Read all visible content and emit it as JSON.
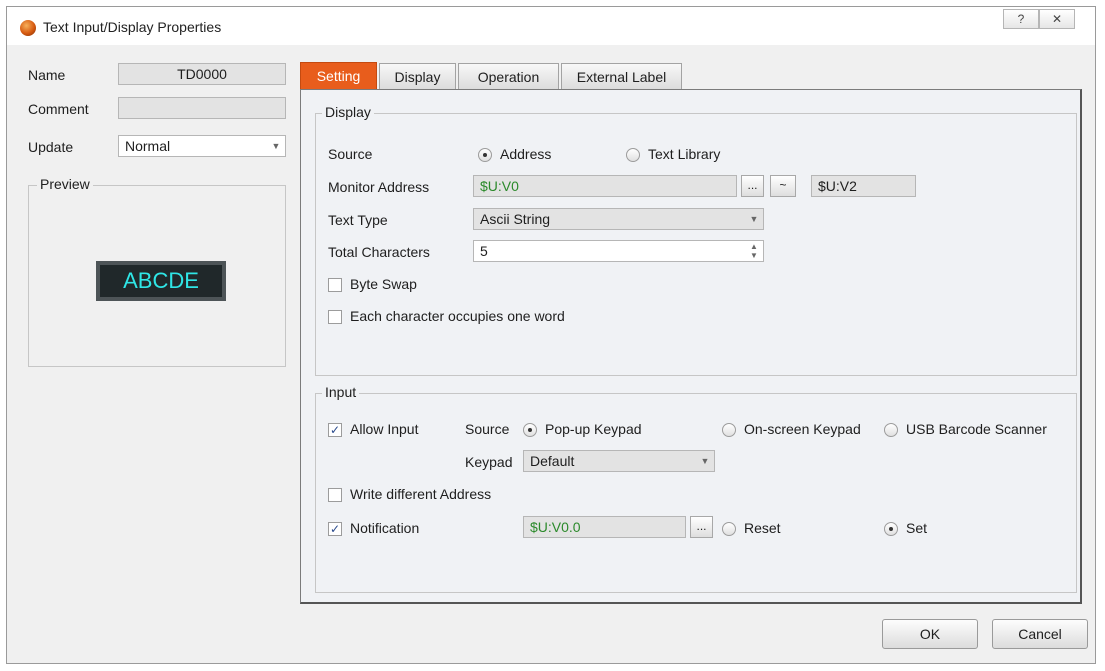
{
  "window": {
    "title": "Text Input/Display Properties",
    "help_label": "?",
    "close_label": "✕"
  },
  "left": {
    "name_label": "Name",
    "name_value": "TD0000",
    "comment_label": "Comment",
    "comment_value": "",
    "update_label": "Update",
    "update_value": "Normal",
    "preview_label": "Preview",
    "preview_text": "ABCDE"
  },
  "tabs": [
    {
      "label": "Setting",
      "active": true
    },
    {
      "label": "Display",
      "active": false
    },
    {
      "label": "Operation",
      "active": false
    },
    {
      "label": "External Label",
      "active": false
    }
  ],
  "display": {
    "group_label": "Display",
    "source_label": "Source",
    "source_address": "Address",
    "source_text_library": "Text Library",
    "monitor_address_label": "Monitor Address",
    "monitor_address_value": "$U:V0",
    "browse_label": "...",
    "range_label": "~",
    "monitor_address_end": "$U:V2",
    "text_type_label": "Text Type",
    "text_type_value": "Ascii String",
    "total_chars_label": "Total Characters",
    "total_chars_value": "5",
    "byte_swap_label": "Byte Swap",
    "each_char_label": "Each character occupies one word"
  },
  "input": {
    "group_label": "Input",
    "allow_input_label": "Allow Input",
    "allow_input_checked": true,
    "source_label": "Source",
    "popup_keypad": "Pop-up Keypad",
    "onscreen_keypad": "On-screen Keypad",
    "usb_barcode": "USB Barcode Scanner",
    "keypad_label": "Keypad",
    "keypad_value": "Default",
    "write_diff_label": "Write different Address",
    "notification_label": "Notification",
    "notification_checked": true,
    "notification_value": "$U:V0.0",
    "browse_label": "...",
    "reset_label": "Reset",
    "set_label": "Set"
  },
  "footer": {
    "ok_label": "OK",
    "cancel_label": "Cancel"
  },
  "colors": {
    "active_tab": "#e85d1c",
    "preview_text": "#2fe6e6",
    "address_text": "#2b8a2b"
  }
}
